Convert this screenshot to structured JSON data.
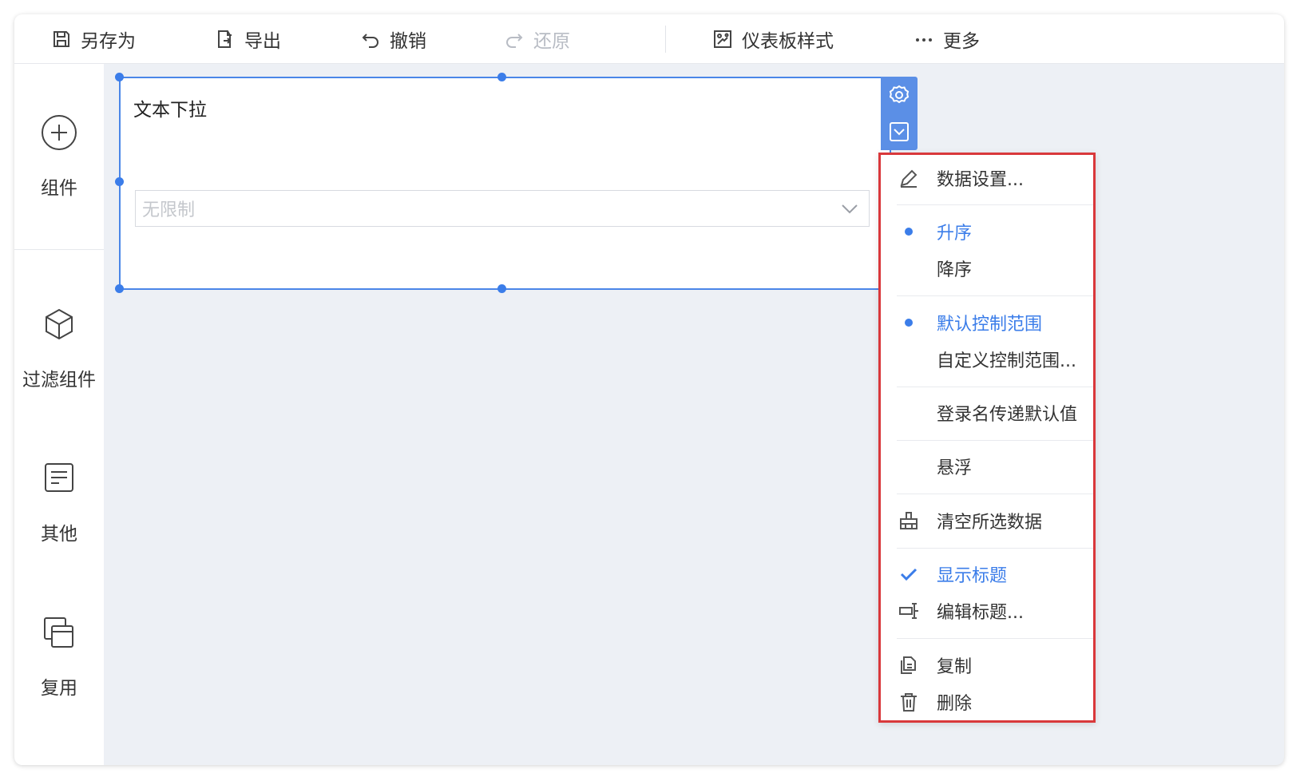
{
  "toolbar": {
    "save_as": "另存为",
    "export": "导出",
    "undo": "撤销",
    "redo": "还原",
    "dashboard_style": "仪表板样式",
    "more": "更多"
  },
  "sidebar": {
    "components": "组件",
    "filter_components": "过滤组件",
    "other": "其他",
    "reuse": "复用"
  },
  "widget": {
    "title": "文本下拉",
    "select_value": "无限制"
  },
  "menu": {
    "data_settings": "数据设置...",
    "ascending": "升序",
    "descending": "降序",
    "default_range": "默认控制范围",
    "custom_range": "自定义控制范围...",
    "login_default": "登录名传递默认值",
    "float": "悬浮",
    "clear_selection": "清空所选数据",
    "show_title": "显示标题",
    "edit_title": "编辑标题...",
    "copy": "复制",
    "delete": "删除"
  },
  "colors": {
    "accent": "#3b7de9",
    "highlight_border": "#d9383b",
    "canvas": "#edf0f5"
  }
}
